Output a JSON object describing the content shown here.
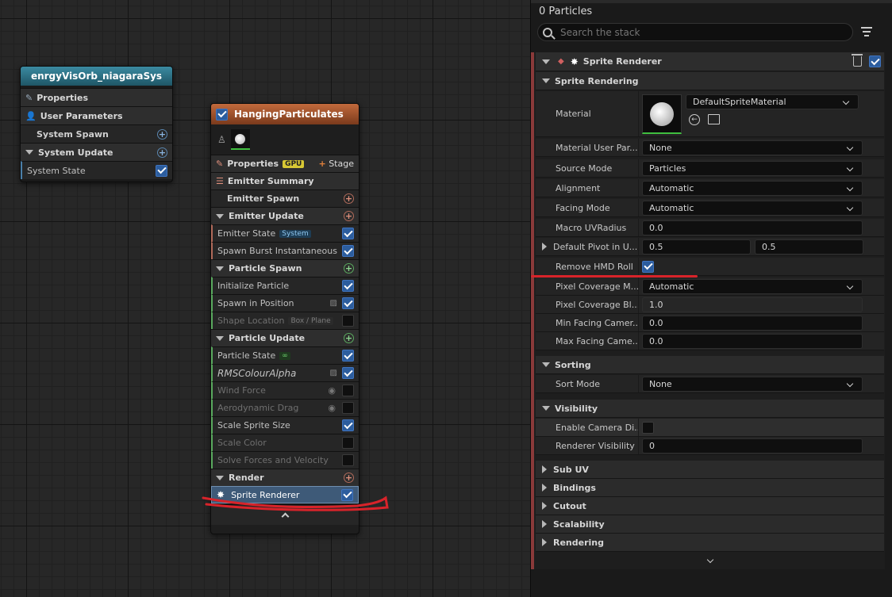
{
  "graph": {
    "system_node": {
      "title": "enrgyVisOrb_niagaraSys",
      "rows": [
        "Properties",
        "User Parameters",
        "System Spawn",
        "System Update",
        "System State"
      ]
    },
    "emitter_node": {
      "title": "HangingParticulates",
      "properties_label": "Properties",
      "gpu_tag": "GPU",
      "stage_label": "Stage",
      "emitter_summary": "Emitter Summary",
      "emitter_spawn": "Emitter Spawn",
      "emitter_update": "Emitter Update",
      "emitter_state": "Emitter State",
      "emitter_state_tag": "System",
      "spawn_burst": "Spawn Burst Instantaneous",
      "particle_spawn": "Particle Spawn",
      "initialize_particle": "Initialize Particle",
      "spawn_in_position": "Spawn in Position",
      "shape_location": "Shape Location",
      "shape_location_tag": "Box / Plane",
      "particle_update": "Particle Update",
      "particle_state": "Particle State",
      "particle_state_tag": "∞",
      "rms_colour_alpha": "RMSColourAlpha",
      "wind_force": "Wind Force",
      "aerodynamic_drag": "Aerodynamic Drag",
      "scale_sprite_size": "Scale Sprite Size",
      "scale_color": "Scale Color",
      "solve_forces": "Solve Forces and Velocity",
      "render": "Render",
      "sprite_renderer": "Sprite Renderer"
    }
  },
  "panel": {
    "particles_count": "0 Particles",
    "search_placeholder": "Search the stack",
    "header_title": "Sprite Renderer",
    "section_sprite_rendering": "Sprite Rendering",
    "material_label": "Material",
    "material_value": "DefaultSpriteMaterial",
    "material_user_param_label": "Material User Par...",
    "material_user_param_value": "None",
    "source_mode_label": "Source Mode",
    "source_mode_value": "Particles",
    "alignment_label": "Alignment",
    "alignment_value": "Automatic",
    "facing_mode_label": "Facing Mode",
    "facing_mode_value": "Automatic",
    "macro_uv_label": "Macro UVRadius",
    "macro_uv_value": "0.0",
    "pivot_label": "Default Pivot in U...",
    "pivot_x": "0.5",
    "pivot_y": "0.5",
    "remove_hmd_label": "Remove HMD Roll",
    "pixel_coverage_mode_label": "Pixel Coverage M...",
    "pixel_coverage_mode_value": "Automatic",
    "pixel_coverage_blend_label": "Pixel Coverage Bl...",
    "pixel_coverage_blend_value": "1.0",
    "min_facing_label": "Min Facing Camer...",
    "min_facing_value": "0.0",
    "max_facing_label": "Max Facing Came...",
    "max_facing_value": "0.0",
    "section_sorting": "Sorting",
    "sort_mode_label": "Sort Mode",
    "sort_mode_value": "None",
    "section_visibility": "Visibility",
    "enable_camera_label": "Enable Camera Di...",
    "renderer_visibility_label": "Renderer Visibility",
    "renderer_visibility_value": "0",
    "section_sub_uv": "Sub UV",
    "section_bindings": "Bindings",
    "section_cutout": "Cutout",
    "section_scalability": "Scalability",
    "section_rendering": "Rendering"
  },
  "colors": {
    "accent_blue": "#2c5d9e",
    "system_header": "#2a6f83",
    "emitter_header": "#a0522d",
    "annotation_red": "#d8232a"
  }
}
